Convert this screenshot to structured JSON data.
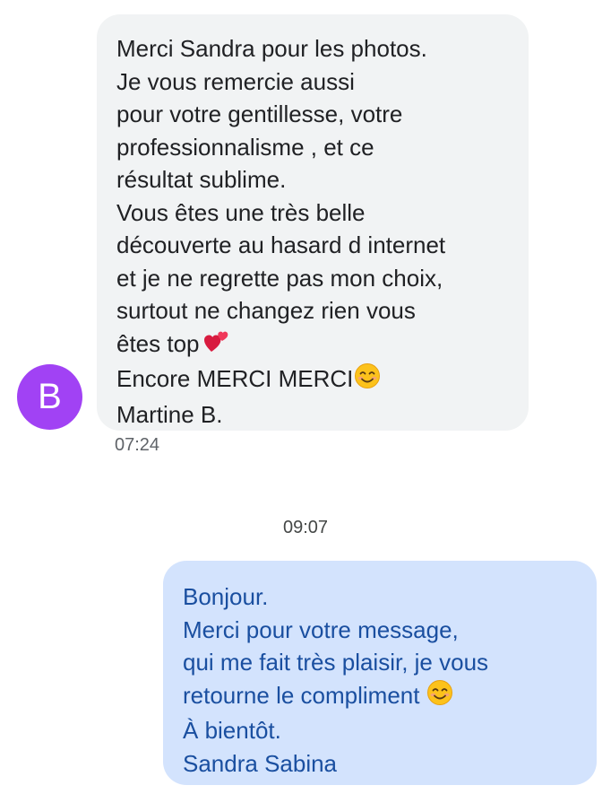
{
  "incoming": {
    "avatar_letter": "B",
    "avatar_color": "#a142f4",
    "bubble_color": "#f1f3f4",
    "lines": [
      "Merci Sandra pour les photos.",
      "Je vous remercie aussi",
      "pour votre gentillesse, votre",
      "professionnalisme , et ce",
      "résultat sublime.",
      "Vous êtes une très belle",
      "découverte au hasard d internet",
      "et je ne regrette pas mon choix,",
      "surtout ne changez rien vous",
      "êtes top",
      "Encore MERCI MERCI",
      "Martine B."
    ],
    "emoji_line_9": "two-hearts-icon",
    "emoji_line_10": "smiling-face-icon",
    "time": "07:24"
  },
  "divider_time": "09:07",
  "outgoing": {
    "bubble_color": "#d3e3fd",
    "text_color": "#1a4fa0",
    "lines": [
      "Bonjour.",
      "Merci pour votre message,",
      "qui me fait très plaisir, je vous",
      "retourne le compliment",
      "À bientôt.",
      "Sandra Sabina"
    ],
    "emoji_line_3": "smiling-face-icon"
  }
}
